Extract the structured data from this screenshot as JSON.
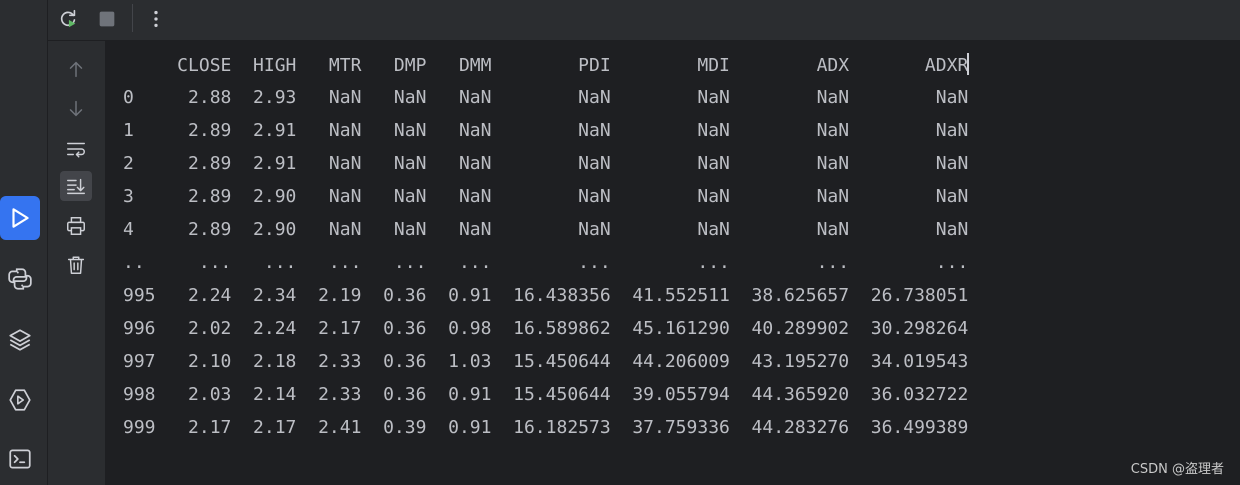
{
  "colors": {
    "background": "#1e1f22",
    "panel": "#2b2d30",
    "text": "#bcbec4",
    "icon": "#ced0d6",
    "icon_dim": "#6f737a",
    "accent": "#3574f0",
    "rerun_green": "#5fb865"
  },
  "toolbar": {
    "icons": [
      "rerun-icon",
      "stop-icon",
      "more-options-icon"
    ]
  },
  "gutter": {
    "icons": [
      "arrow-up-icon",
      "arrow-down-icon",
      "soft-wrap-icon",
      "scroll-to-end-icon",
      "print-icon",
      "trash-icon"
    ]
  },
  "activity": {
    "icons": [
      "run-icon",
      "python-console-icon",
      "layers-icon",
      "services-icon",
      "terminal-icon"
    ]
  },
  "console": {
    "header": "     CLOSE  HIGH   MTR   DMP   DMM        PDI        MDI        ADX       ADXR",
    "rows": [
      "0     2.88  2.93   NaN   NaN   NaN        NaN        NaN        NaN        NaN",
      "1     2.89  2.91   NaN   NaN   NaN        NaN        NaN        NaN        NaN",
      "2     2.89  2.91   NaN   NaN   NaN        NaN        NaN        NaN        NaN",
      "3     2.89  2.90   NaN   NaN   NaN        NaN        NaN        NaN        NaN",
      "4     2.89  2.90   NaN   NaN   NaN        NaN        NaN        NaN        NaN",
      "..     ...   ...   ...   ...   ...        ...        ...        ...        ...",
      "995   2.24  2.34  2.19  0.36  0.91  16.438356  41.552511  38.625657  26.738051",
      "996   2.02  2.24  2.17  0.36  0.98  16.589862  45.161290  40.289902  30.298264",
      "997   2.10  2.18  2.33  0.36  1.03  15.450644  44.206009  43.195270  34.019543",
      "998   2.03  2.14  2.33  0.36  0.91  15.450644  39.055794  44.365920  36.032722",
      "999   2.17  2.17  2.41  0.39  0.91  16.182573  37.759336  44.283276  36.499389"
    ]
  },
  "watermark": "CSDN @盗理者"
}
